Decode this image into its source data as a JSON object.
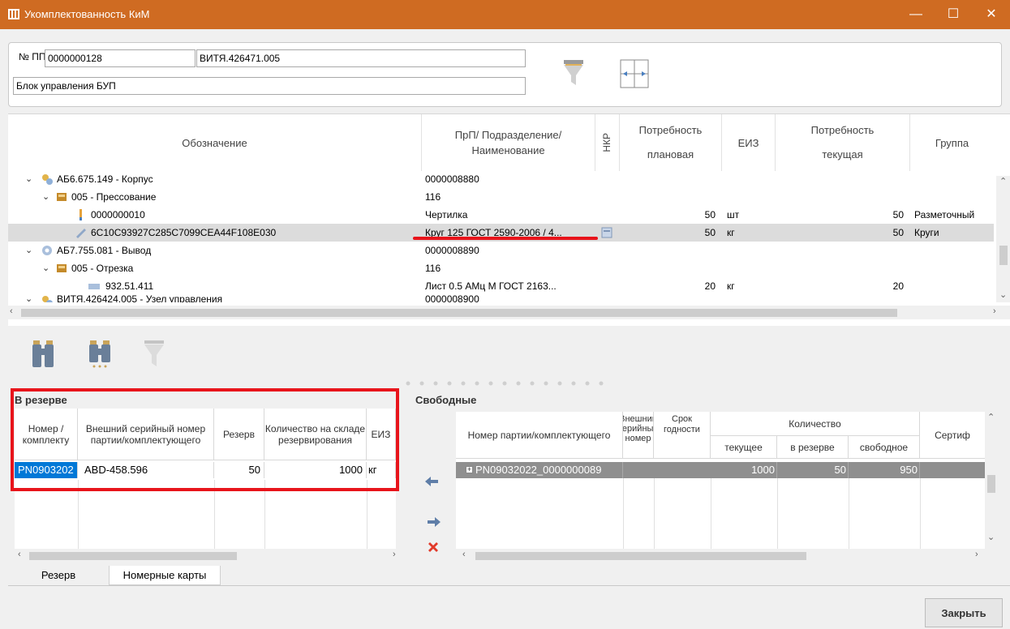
{
  "window": {
    "title": "Укомплектованность КиМ",
    "minimize": "—",
    "maximize": "☐",
    "close": "✕"
  },
  "header": {
    "num_label": "№ ПП",
    "num_value": "0000000128",
    "designation": "ВИТЯ.426471.005",
    "name": "Блок управления БУП"
  },
  "top_grid": {
    "columns": {
      "designation": "Обозначение",
      "prp": "ПрП/ Подразделение/ Наименование",
      "nkr": "НКР",
      "need_planned": "Потребность плановая",
      "unit": "ЕИЗ",
      "need_current": "Потребность текущая",
      "group": "Группа"
    },
    "rows": [
      {
        "designation": "АБ6.675.149 - Корпус",
        "prp": "0000008880",
        "planned": "",
        "unit": "",
        "current": "",
        "group": ""
      },
      {
        "designation": "005 - Прессование",
        "prp": "116",
        "planned": "",
        "unit": "",
        "current": "",
        "group": ""
      },
      {
        "designation": "0000000010",
        "prp": "Чертилка",
        "planned": "50",
        "unit": "шт",
        "current": "50",
        "group": "Разметочный"
      },
      {
        "designation": "6C10C93927C285C7099CEA44F108E030",
        "prp": "Круг 125 ГОСТ 2590-2006 / 4...",
        "planned": "50",
        "unit": "кг",
        "current": "50",
        "group": "Круги"
      },
      {
        "designation": "АБ7.755.081 - Вывод",
        "prp": "0000008890",
        "planned": "",
        "unit": "",
        "current": "",
        "group": ""
      },
      {
        "designation": "005 - Отрезка",
        "prp": "116",
        "planned": "",
        "unit": "",
        "current": "",
        "group": ""
      },
      {
        "designation": "932.51.411",
        "prp": "Лист 0.5  АМц М  ГОСТ 2163...",
        "planned": "20",
        "unit": "кг",
        "current": "20",
        "group": ""
      },
      {
        "designation": "ВИТЯ.426424.005 - Узел управления",
        "prp": "0000008900",
        "planned": "",
        "unit": "",
        "current": "",
        "group": ""
      }
    ]
  },
  "reserve": {
    "title": "В резерве",
    "columns": {
      "number": "Номер /комплекту",
      "serial": "Внешний серийный номер партии/комплектующего",
      "reserve": "Резерв",
      "qty": "Количество на складе резервирования",
      "unit": "ЕИЗ"
    },
    "rows": [
      {
        "number": "PN0903202",
        "serial": "ABD-458.596",
        "reserve": "50",
        "qty": "1000",
        "unit": "кг"
      }
    ]
  },
  "free": {
    "title": "Свободные",
    "columns": {
      "number": "Номер партии/комплектующего",
      "ext": "Внешний серийный номер",
      "term": "Срок годности",
      "qty_group": "Количество",
      "current": "текущее",
      "reserved": "в резерве",
      "free": "свободное",
      "cert": "Сертиф"
    },
    "rows": [
      {
        "number": "PN09032022_0000000089",
        "current": "1000",
        "reserved": "50",
        "free": "950"
      }
    ]
  },
  "tabs": [
    "Резерв",
    "Номерные карты"
  ],
  "buttons": {
    "close": "Закрыть"
  },
  "colors": {
    "titlebar": "#cf6b22",
    "highlight": "#e8141b",
    "selection": "#0078d7"
  }
}
